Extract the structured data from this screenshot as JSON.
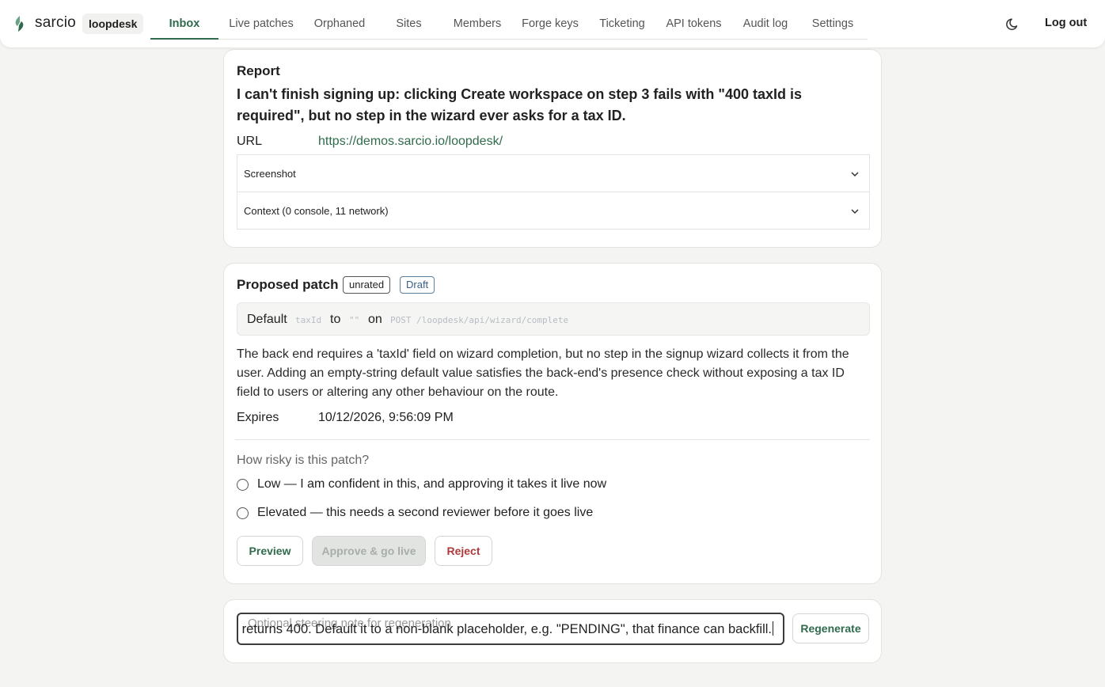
{
  "header": {
    "brand": "sarcio",
    "project": "loopdesk",
    "nav": [
      {
        "label": "Inbox",
        "active": true
      },
      {
        "label": "Live patches"
      },
      {
        "label": "Orphaned"
      },
      {
        "label": "Sites"
      },
      {
        "label": "Members"
      },
      {
        "label": "Forge keys"
      },
      {
        "label": "Ticketing"
      },
      {
        "label": "API tokens"
      },
      {
        "label": "Audit log"
      },
      {
        "label": "Settings"
      }
    ],
    "theme_icon": "moon-icon",
    "logout_label": "Log out"
  },
  "report": {
    "heading": "Report",
    "text": "I can't finish signing up: clicking Create workspace on step 3 fails with \"400 taxId is required\", but no step in the wizard ever asks for a tax ID.",
    "url_label": "URL",
    "url": "https://demos.sarcio.io/loopdesk/",
    "screenshot_label": "Screenshot",
    "context_label": "Context (0 console, 11 network)"
  },
  "patch": {
    "heading": "Proposed patch",
    "badge_rating": "unrated",
    "badge_status": "Draft",
    "code": {
      "word_default": "Default",
      "field": "taxId",
      "word_to": "to",
      "value": "\"\"",
      "word_on": "on",
      "route": "POST /loopdesk/api/wizard/complete"
    },
    "description": "The back end requires a 'taxId' field on wizard completion, but no step in the signup wizard collects it from the user. Adding an empty-string default value satisfies the back-end's presence check without exposing a tax ID field to users or altering any other behaviour on the route.",
    "expires_label": "Expires",
    "expires_value": "10/12/2026, 9:56:09 PM",
    "risk_question": "How risky is this patch?",
    "risk_options": [
      "Low — I am confident in this, and approving it takes it live now",
      "Elevated — this needs a second reviewer before it goes live"
    ],
    "preview_label": "Preview",
    "approve_label": "Approve & go live",
    "reject_label": "Reject"
  },
  "regenerate": {
    "placeholder": "Optional steering note for regeneration",
    "value": "returns 400. Default it to a non-blank placeholder, e.g. \"PENDING\", that finance can backfill.",
    "button_label": "Regenerate"
  },
  "colors": {
    "accent": "#2f6b4c",
    "danger": "#b03a3a",
    "draft": "#3a6088"
  }
}
